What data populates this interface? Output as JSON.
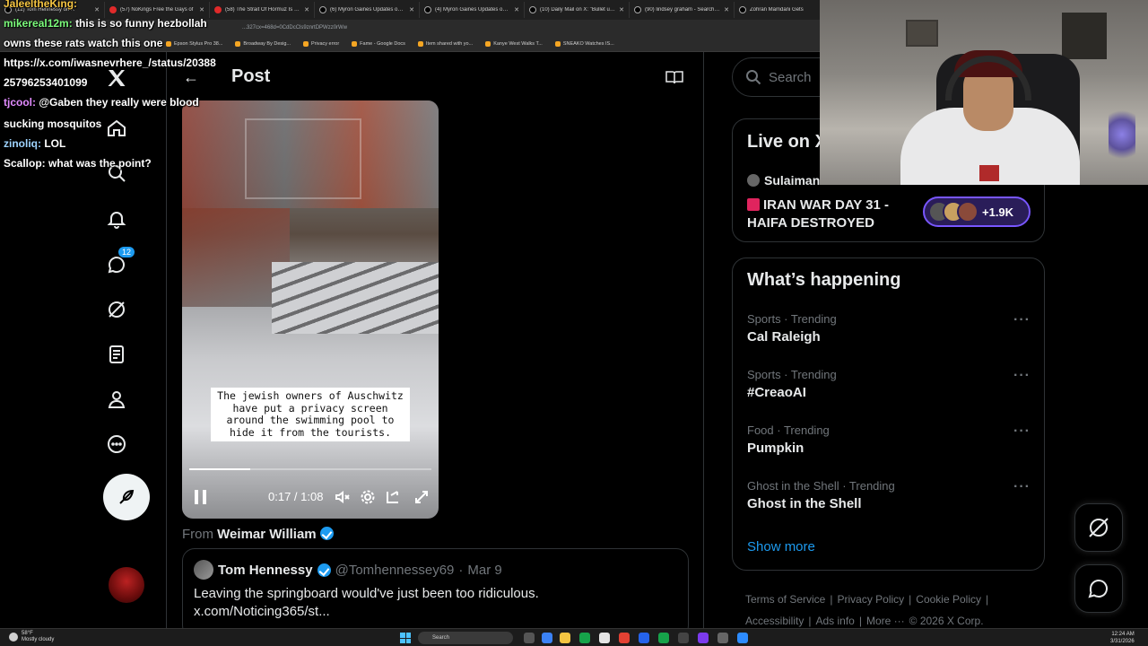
{
  "browser": {
    "tabs": [
      {
        "label": "(12) Tom Hennessy on X",
        "fav": "x"
      },
      {
        "label": "(57) NoKings Free the Gays of",
        "fav": "red"
      },
      {
        "label": "(58) The Strait Of Hormuz Is No",
        "fav": "red"
      },
      {
        "label": "(6) Myron Gaines Updates on X",
        "fav": "x"
      },
      {
        "label": "(4) Myron Gaines Updates on X",
        "fav": "x"
      },
      {
        "label": "(10) Daily Mail on X: \"Bullet use",
        "fav": "x"
      },
      {
        "label": "(90) lindsey graham - Search / X",
        "fav": "x"
      },
      {
        "label": "Zohran Mamdani Gets",
        "fav": "x"
      }
    ],
    "address": "...327cx=468d=0CdDcCls9znrtDPWzz0rWw",
    "bookmarks": [
      "Epson Stylus Pro 38...",
      "Broadway By Desig...",
      "Privacy error",
      "Fame - Google Docs",
      "Item shared with yo...",
      "Kanye West Walks T...",
      "SNEAKO Watches IS..."
    ]
  },
  "chat": [
    {
      "user": "JaleeltheKing:",
      "text": "",
      "color": "#f5c542"
    },
    {
      "user": "mikereal12m:",
      "text": "this is so funny hezbollah",
      "color": "#7cfc7c"
    },
    {
      "user": "",
      "text": "owns these rats watch this one",
      "color": "#ffffff"
    },
    {
      "user": "",
      "text": "https://x.com/iwasnevrhere_/status/20388",
      "color": "#ffffff"
    },
    {
      "user": "",
      "text": "25796253401099",
      "color": "#ffffff"
    },
    {
      "user": "tjcool:",
      "text": "@Gaben they really were blood",
      "color": "#e28bff"
    },
    {
      "user": "",
      "text": "sucking mosquitos",
      "color": "#ffffff"
    },
    {
      "user": "zinoliq:",
      "text": "LOL",
      "color": "#9fd4ff"
    },
    {
      "user": "Scallop:",
      "text": "what was the point?",
      "color": "#ffffff"
    }
  ],
  "nav": {
    "messages_badge": "12"
  },
  "header": {
    "title": "Post"
  },
  "video": {
    "caption": "The jewish owners of Auschwitz have put a privacy screen around the swimming pool to hide it from the tourists.",
    "time": "0:17 / 1:08",
    "progress": 0.25
  },
  "from": {
    "prefix": "From",
    "name": "Weimar William"
  },
  "quote": {
    "name": "Tom Hennessy",
    "handle": "@Tomhennessey69",
    "sep": "·",
    "date": "Mar 9",
    "text_line1": "Leaving the springboard would've just been too ridiculous.",
    "text_line2": "x.com/Noticing365/st..."
  },
  "right": {
    "search_placeholder": "Search",
    "live_title": "Live on X",
    "live_host": "Sulaiman",
    "live_topic": "IRAN WAR DAY 31 - HAIFA DESTROYED",
    "live_count": "+1.9K",
    "happening_title": "What’s happening",
    "trends": [
      {
        "meta": "Sports · Trending",
        "name": "Cal Raleigh"
      },
      {
        "meta": "Sports · Trending",
        "name": "#CreaoAI"
      },
      {
        "meta": "Food · Trending",
        "name": "Pumpkin"
      },
      {
        "meta": "Ghost in the Shell · Trending",
        "name": "Ghost in the Shell"
      }
    ],
    "show_more": "Show more",
    "footer_line1": [
      "Terms of Service",
      "|",
      "Privacy Policy",
      "|",
      "Cookie Policy",
      "|"
    ],
    "footer_line2": [
      "Accessibility",
      "|",
      "Ads info",
      "|",
      "More ···",
      "© 2026 X Corp."
    ]
  },
  "taskbar": {
    "temp": "58°F",
    "weather": "Mostly cloudy",
    "search": "Search",
    "time": "12:24 AM",
    "date": "3/31/2026"
  },
  "colors": {
    "accent": "#1d9bf0",
    "live_purple": "#7856ff",
    "background": "#000000",
    "border": "#2f3336",
    "muted": "#71767b"
  }
}
